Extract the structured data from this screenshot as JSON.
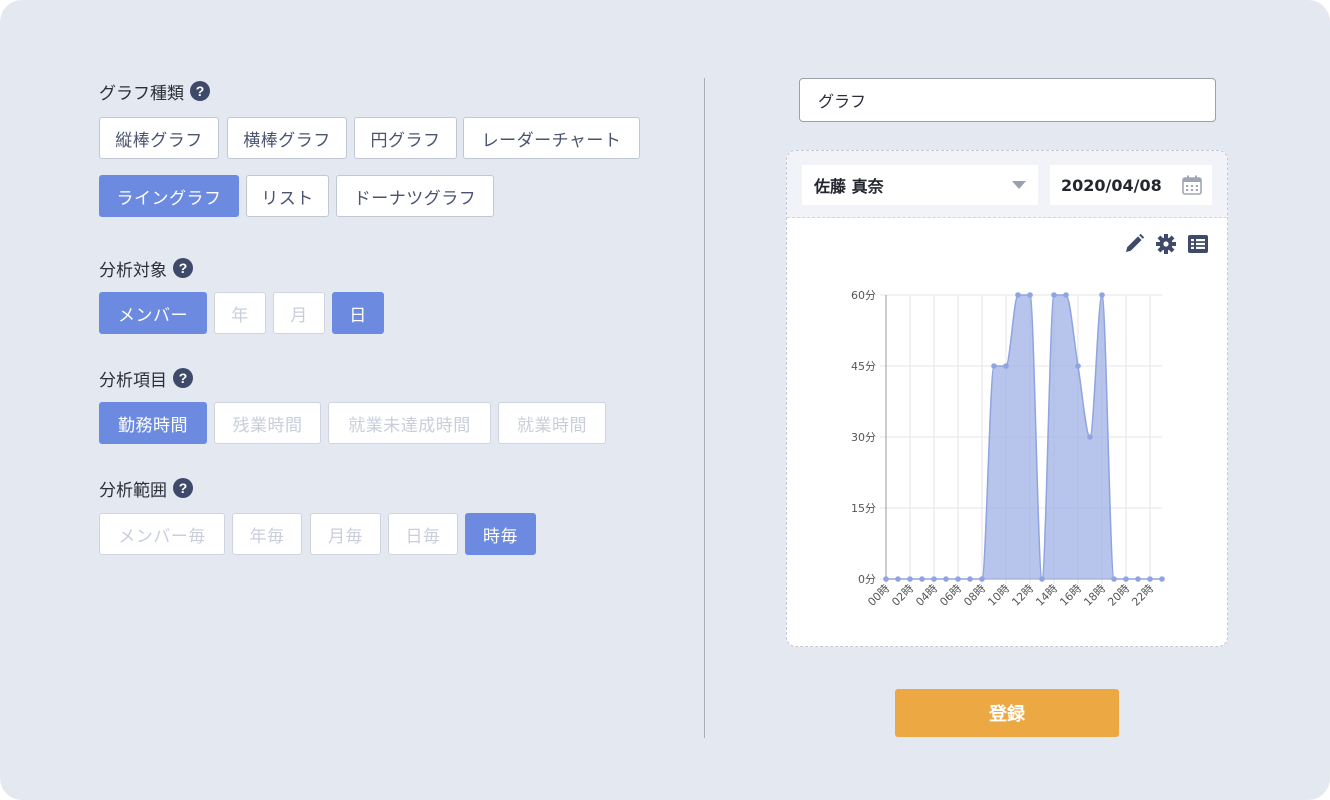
{
  "sections": {
    "graph_type": {
      "title": "グラフ種類",
      "options": [
        "縦棒グラフ",
        "横棒グラフ",
        "円グラフ",
        "レーダーチャート",
        "ライングラフ",
        "リスト",
        "ドーナツグラフ"
      ],
      "selected": "ライングラフ"
    },
    "target": {
      "title": "分析対象",
      "options": [
        "メンバー",
        "年",
        "月",
        "日"
      ],
      "selected": [
        "メンバー",
        "日"
      ]
    },
    "item": {
      "title": "分析項目",
      "options": [
        "勤務時間",
        "残業時間",
        "就業未達成時間",
        "就業時間"
      ],
      "selected": "勤務時間"
    },
    "range": {
      "title": "分析範囲",
      "options": [
        "メンバー毎",
        "年毎",
        "月毎",
        "日毎",
        "時毎"
      ],
      "selected": "時毎"
    }
  },
  "help_glyph": "?",
  "graph_title_value": "グラフ",
  "member": "佐藤 真奈",
  "date": "2020/04/08",
  "submit_label": "登録",
  "icons": [
    "help-icon",
    "caret-down-icon",
    "calendar-icon",
    "pencil-icon",
    "gear-icon",
    "list-icon"
  ],
  "colors": {
    "background": "#e4e8f1",
    "active_button": "#6b8ae0",
    "chart_fill": "#9fb2e6",
    "chart_point": "#8fa4e0",
    "submit_button": "#eca842"
  },
  "chart_data": {
    "type": "area",
    "x": [
      "00時",
      "01時",
      "02時",
      "03時",
      "04時",
      "05時",
      "06時",
      "07時",
      "08時",
      "09時",
      "10時",
      "11時",
      "12時",
      "13時",
      "14時",
      "15時",
      "16時",
      "17時",
      "18時",
      "19時",
      "20時",
      "21時",
      "22時",
      "23時"
    ],
    "x_tick_labels": [
      "00時",
      "02時",
      "04時",
      "06時",
      "08時",
      "10時",
      "12時",
      "14時",
      "16時",
      "18時",
      "20時",
      "22時"
    ],
    "values": [
      0,
      0,
      0,
      0,
      0,
      0,
      0,
      0,
      0,
      45,
      45,
      60,
      60,
      0,
      60,
      60,
      45,
      30,
      60,
      0,
      0,
      0,
      0,
      0
    ],
    "y_tick_labels": [
      "0分",
      "15分",
      "30分",
      "45分",
      "60分"
    ],
    "ylim": [
      0,
      60
    ],
    "grid": true,
    "legend": "none"
  }
}
